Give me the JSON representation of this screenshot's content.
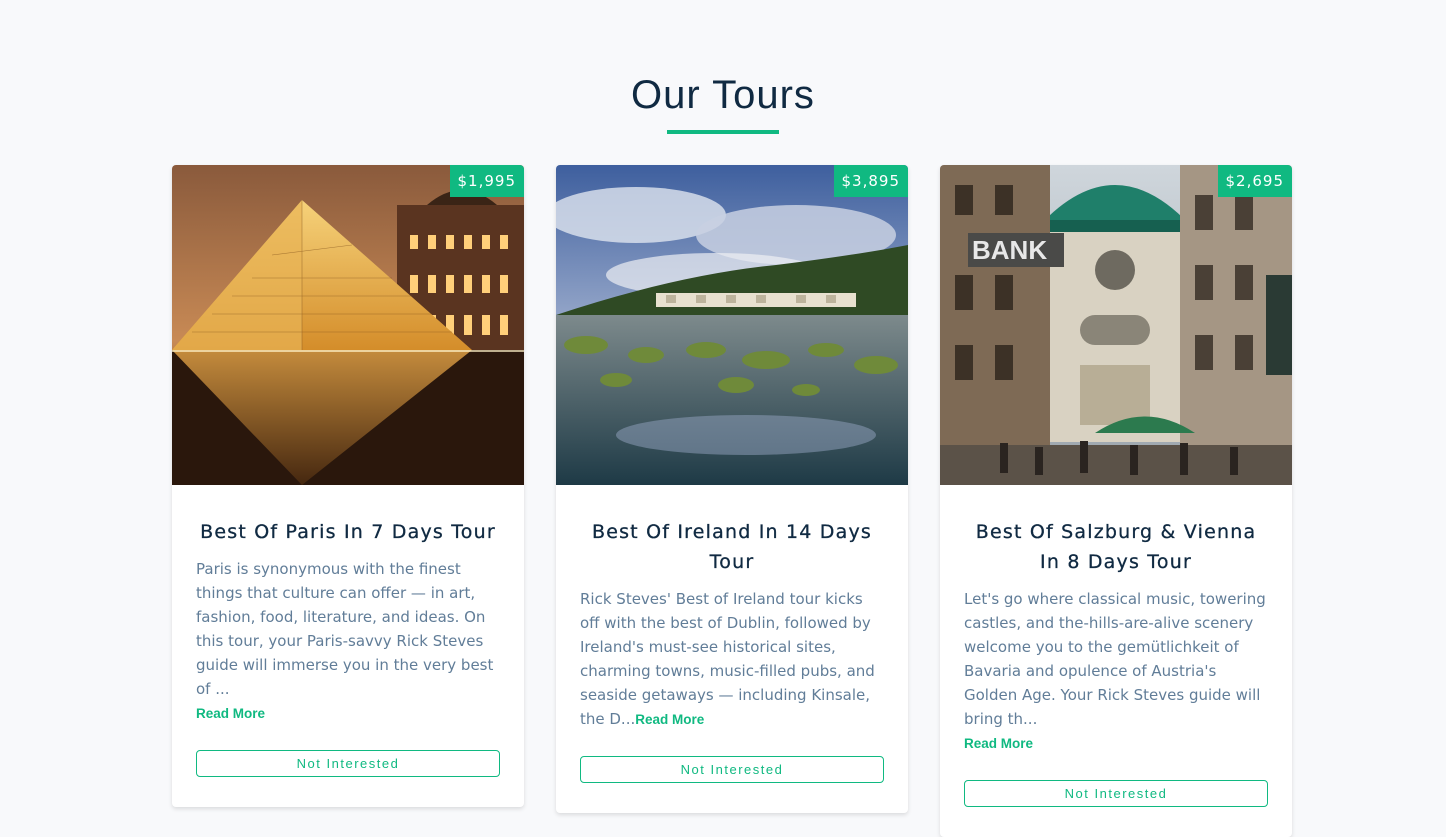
{
  "section": {
    "title": "Our Tours"
  },
  "colors": {
    "accent": "#10b981",
    "heading": "#102a42",
    "body_text": "#617d98"
  },
  "tours": [
    {
      "price": "$1,995",
      "name": "Best Of Paris In 7 Days Tour",
      "info": "Paris is synonymous with the finest things that culture can offer — in art, fashion, food, literature, and ideas. On this tour, your Paris-savvy Rick Steves guide will immerse you in the very best of ...",
      "read_more": "Read More",
      "button": "Not Interested"
    },
    {
      "price": "$3,895",
      "name": "Best Of Ireland In 14 Days Tour",
      "info": "Rick Steves' Best of Ireland tour kicks off with the best of Dublin, followed by Ireland's must-see historical sites, charming towns, music-filled pubs, and seaside getaways — including Kinsale, the D...",
      "read_more": "Read More",
      "button": "Not Interested"
    },
    {
      "price": "$2,695",
      "name": "Best Of Salzburg & Vienna In 8 Days Tour",
      "info": "Let's go where classical music, towering castles, and the-hills-are-alive scenery welcome you to the gemütlichkeit of Bavaria and opulence of Austria's Golden Age. Your Rick Steves guide will bring th...",
      "read_more": "Read More",
      "button": "Not Interested"
    }
  ]
}
